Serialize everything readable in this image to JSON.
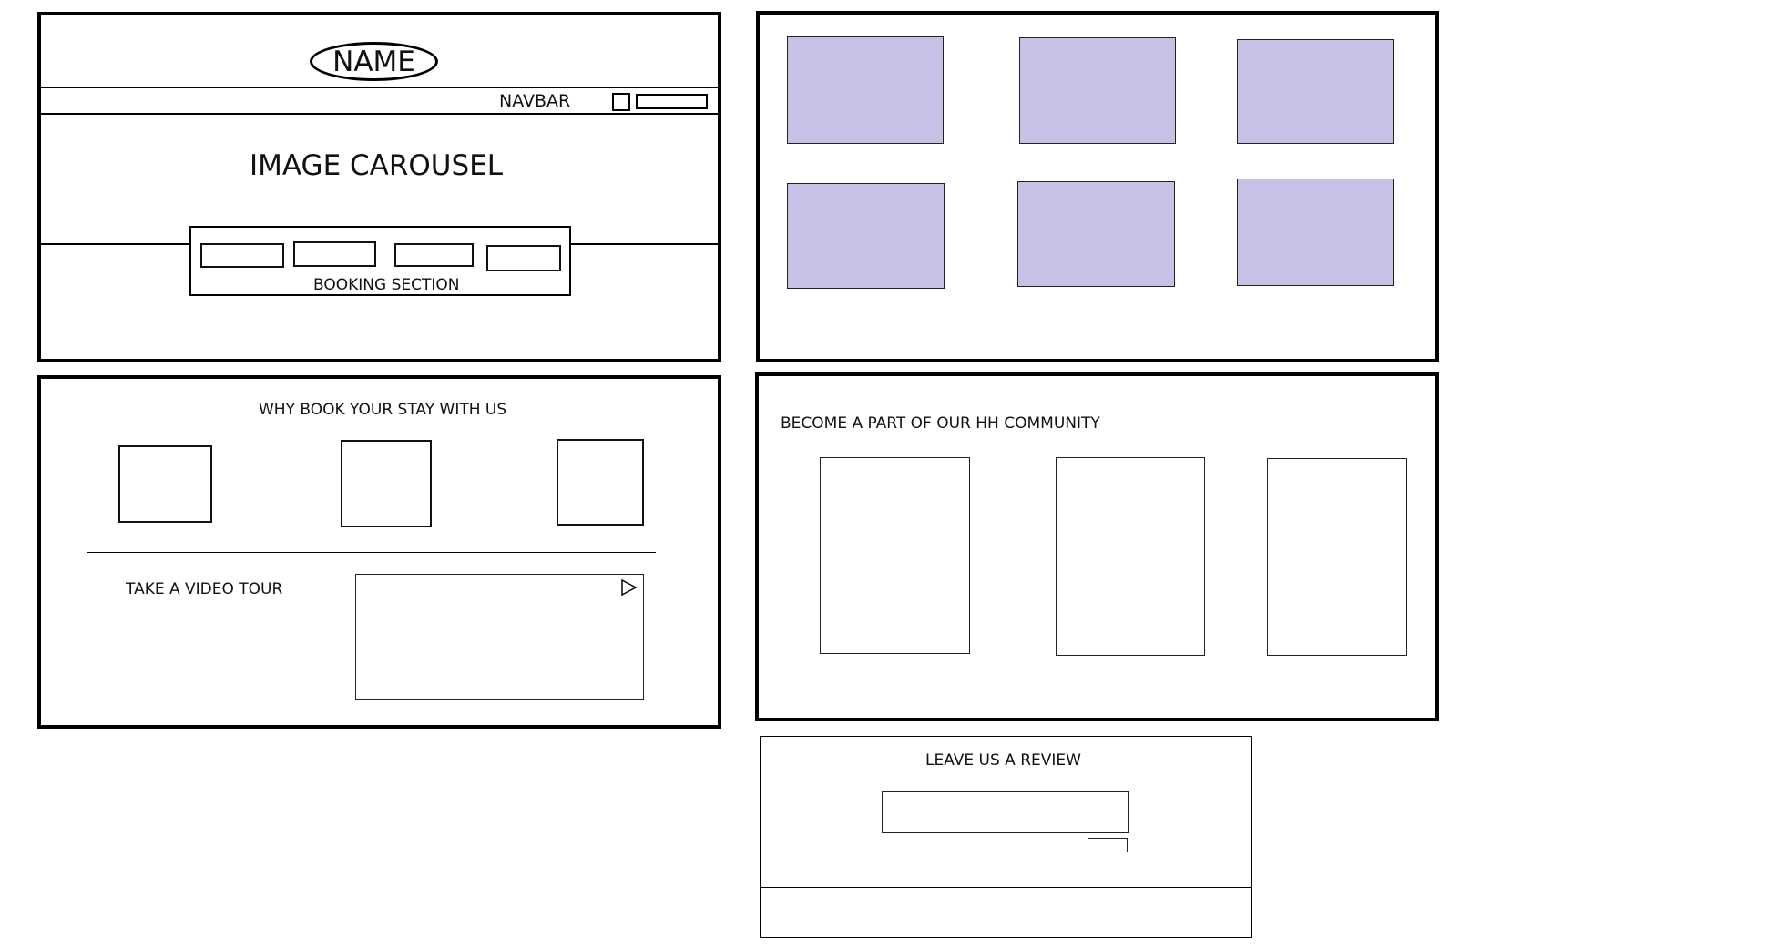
{
  "header": {
    "name_label": "NAME",
    "navbar_label": "NAVBAR"
  },
  "hero": {
    "carousel_label": "IMAGE CAROUSEL",
    "booking_label": "BOOKING SECTION"
  },
  "why_section": {
    "title": "WHY BOOK YOUR STAY WITH US",
    "video_label": "TAKE A VIDEO TOUR"
  },
  "community_section": {
    "title": "BECOME A PART OF OUR HH COMMUNITY"
  },
  "review_section": {
    "title": "LEAVE US A REVIEW"
  },
  "colors": {
    "tile_fill": "#c8c0e6",
    "border": "#000000"
  },
  "icons": {
    "video_play": "play-icon"
  }
}
